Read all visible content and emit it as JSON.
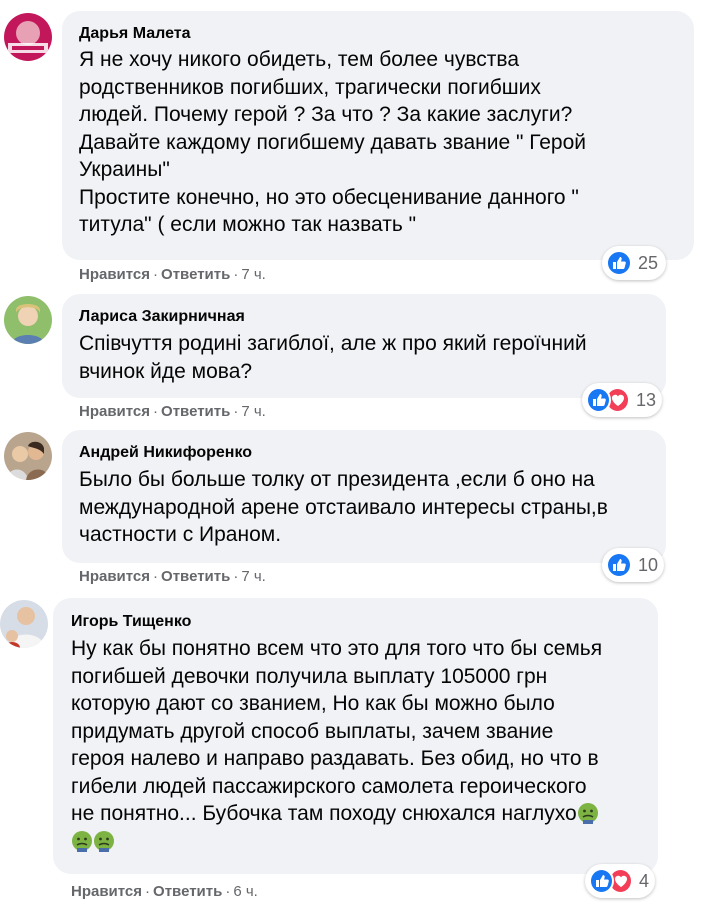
{
  "comments": [
    {
      "author": "Дарья Малета",
      "lines": [
        "Я не хочу никого обидеть, тем более чувства",
        "родственников погибших, трагически погибших",
        "людей. Почему герой ? За что ? За какие заслуги?",
        "Давайте каждому погибшему давать звание \" Герой",
        "Украины\"",
        "Простите конечно, но это обесценивание данного \"",
        "титула\" ( если можно так назвать \""
      ],
      "like_label": "Нравится",
      "reply_label": "Ответить",
      "time": "7 ч.",
      "reaction_count": "25",
      "reactions": [
        "like-icon"
      ]
    },
    {
      "author": "Лариса Закирничная",
      "lines": [
        "Співчуття родині загиблої, але ж про який героїчний",
        "вчинок йде мова?"
      ],
      "like_label": "Нравится",
      "reply_label": "Ответить",
      "time": "7 ч.",
      "reaction_count": "13",
      "reactions": [
        "like-icon",
        "love-icon"
      ]
    },
    {
      "author": "Андрей Никифоренко",
      "lines": [
        "Было бы больше толку от президента ,если б оно на",
        "международной арене отстаивало интересы страны,в",
        "частности с Ираном."
      ],
      "like_label": "Нравится",
      "reply_label": "Ответить",
      "time": "7 ч.",
      "reaction_count": "10",
      "reactions": [
        "like-icon"
      ]
    },
    {
      "author": "Игорь Тищенко",
      "lines": [
        "Ну как бы понятно всем что это для того что бы семья",
        "погибшей девочки получила выплату 105000 грн",
        "которую дают со званием, Но как бы можно было",
        "придумать другой способ выплаты, зачем звание",
        "героя налево и направо раздавать. Без обид, но что в",
        "гибели людей пассажирского самолета героического",
        "не понятно... Бубочка там походу снюхался наглухо"
      ],
      "like_label": "Нравится",
      "reply_label": "Ответить",
      "time": "6 ч.",
      "reaction_count": "4",
      "reactions": [
        "like-icon",
        "love-icon"
      ],
      "trailing_emoji": "nauseated-face-icon"
    }
  ],
  "colors": {
    "bubble": "#f0f2f5",
    "secondary_text": "#65676b",
    "like_blue": "#1877f2",
    "love_red": "#f33e58"
  }
}
